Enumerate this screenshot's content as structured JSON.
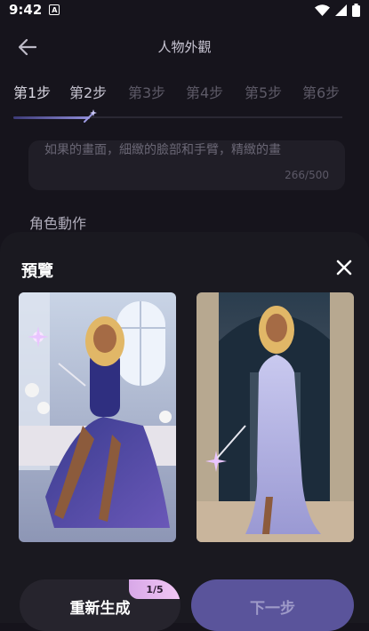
{
  "status": {
    "time": "9:42",
    "notif_glyph": "A"
  },
  "header": {
    "title": "人物外觀",
    "back_icon": "arrow-left-icon"
  },
  "steps": [
    {
      "label": "第1步",
      "state": "done"
    },
    {
      "label": "第2步",
      "state": "current"
    },
    {
      "label": "第3步",
      "state": "upcoming"
    },
    {
      "label": "第4步",
      "state": "upcoming"
    },
    {
      "label": "第5步",
      "state": "upcoming"
    },
    {
      "label": "第6步",
      "state": "upcoming"
    }
  ],
  "progress": {
    "fraction": 0.23
  },
  "description": {
    "text": "如果的畫面，細緻的臉部和手臂，精緻的畫",
    "counter": "266/500"
  },
  "section": {
    "label": "角色動作"
  },
  "sheet": {
    "title": "預覽",
    "close_icon": "close-icon",
    "previews": [
      {
        "name": "preview-image-1",
        "subject": "seated woman in navy gown holding sparkling wand by window"
      },
      {
        "name": "preview-image-2",
        "subject": "standing woman in lavender gown holding wand in stone archway"
      }
    ],
    "regenerate_label": "重新生成",
    "regenerate_badge": "1/5",
    "next_label": "下一步"
  },
  "colors": {
    "background": "#16141c",
    "sheet": "#1a1920",
    "accent": "#5a549b",
    "badge": "#e9b8f0"
  }
}
